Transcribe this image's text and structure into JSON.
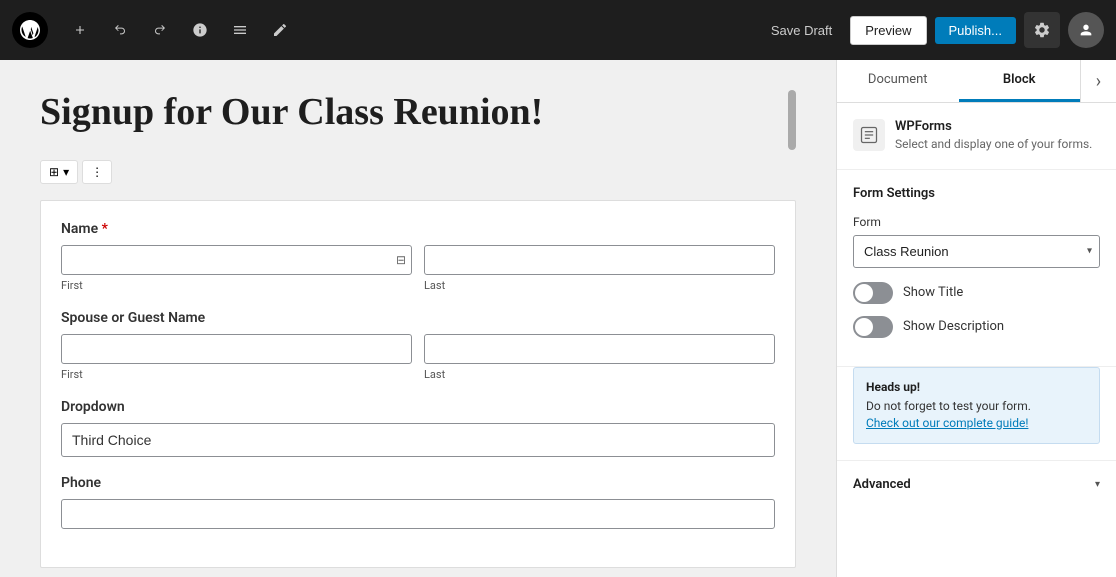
{
  "toolbar": {
    "wp_logo_aria": "WordPress",
    "add_block_label": "+",
    "undo_label": "↩",
    "redo_label": "↪",
    "info_label": "ℹ",
    "list_view_label": "≡",
    "tools_label": "✎",
    "save_draft_label": "Save Draft",
    "preview_label": "Preview",
    "publish_label": "Publish...",
    "settings_label": "⚙",
    "user_label": "👤"
  },
  "editor": {
    "page_title": "Signup for Our Class Reunion!",
    "block_toolbar": {
      "form_icon": "⊞",
      "more_options": "⋮"
    },
    "form": {
      "fields": [
        {
          "label": "Name",
          "required": true,
          "type": "name",
          "first_placeholder": "",
          "last_placeholder": "",
          "first_label": "First",
          "last_label": "Last"
        },
        {
          "label": "Spouse or Guest Name",
          "required": false,
          "type": "name",
          "first_placeholder": "",
          "last_placeholder": "",
          "first_label": "First",
          "last_label": "Last"
        },
        {
          "label": "Dropdown",
          "required": false,
          "type": "dropdown",
          "value": "Third Choice"
        },
        {
          "label": "Phone",
          "required": false,
          "type": "phone"
        }
      ]
    }
  },
  "sidebar": {
    "tabs": [
      {
        "label": "Document",
        "active": false
      },
      {
        "label": "Block",
        "active": true
      }
    ],
    "block_info": {
      "icon": "⊞",
      "name": "WPForms",
      "description": "Select and display one of your forms."
    },
    "form_settings": {
      "section_title": "Form Settings",
      "form_field_label": "Form",
      "form_options": [
        "Class Reunion"
      ],
      "selected_form": "Class Reunion",
      "show_title_label": "Show Title",
      "show_title_on": false,
      "show_description_label": "Show Description",
      "show_description_on": false,
      "heads_up_title": "Heads up!",
      "heads_up_text": "Do not forget to test your form.",
      "heads_up_link_text": "Check out our complete guide!",
      "advanced_label": "Advanced"
    }
  }
}
